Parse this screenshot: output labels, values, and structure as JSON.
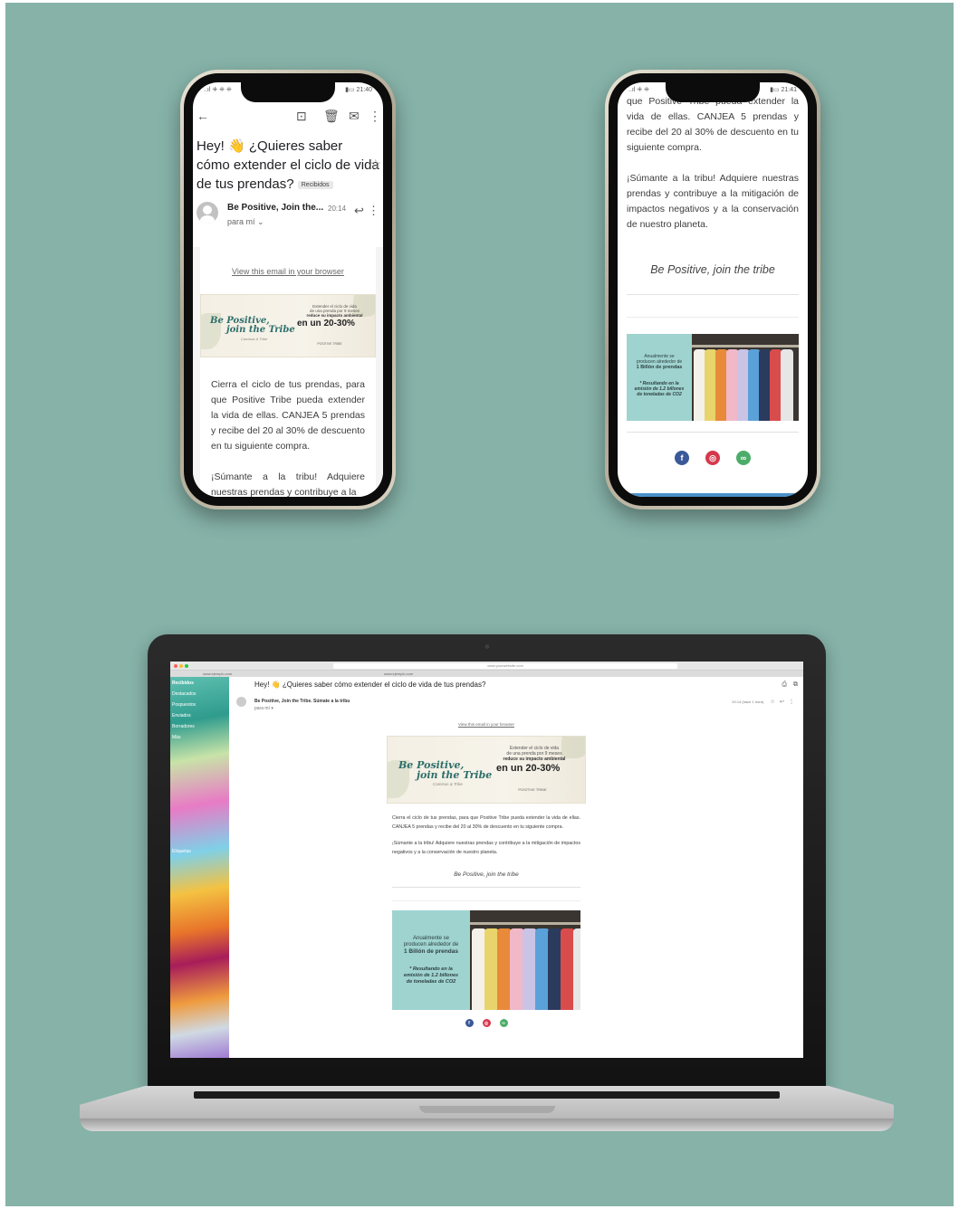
{
  "phone_left": {
    "status_left": "..ıl ⁜ ⁜ ⁜",
    "status_right": "▮▭ 21:40",
    "subject_pre": "Hey! ",
    "subject_emoji": "👋",
    "subject_text": " ¿Quieres saber cómo extender el ciclo de vida de tus prendas?",
    "inbox_label": "Recibidos",
    "sender": "Be Positive, Join the...",
    "time": "20:14",
    "to": "para mí ⌄",
    "view_link": "View this email in your browser",
    "paragraph1": "Cierra el ciclo de tus prendas, para que Positive Tribe pueda extender la vida de ellas. CANJEA 5 prendas y recibe del 20 al 30% de descuento en tu siguiente compra.",
    "paragraph2": "¡Súmante a la tribu! Adquiere nuestras prendas y contribuye a la"
  },
  "phone_right": {
    "status_left": "..ıl ⁜ ⁜",
    "status_right": "▮▭ 21:41",
    "paragraph1": "que Positive Tribe pueda extender la vida de ellas. CANJEA 5 prendas y recibe del 20 al 30% de descuento en tu siguiente compra.",
    "paragraph2": "¡Súmante a la tribu! Adquiere nuestras prendas y contribuye a la mitigación de impactos negativos y a la conservación de nuestro planeta.",
    "tagline": "Be Positive, join the tribe"
  },
  "banner": {
    "brand_line1": "Be Positive,",
    "brand_line2": "join the Tribe",
    "brand_sub": "Camisas & Tribe",
    "line1": "Extender el ciclo de vida",
    "line2": "de una prenda por 9 meses",
    "line3": "reduce su impacto ambiental",
    "big": "en un 20-30%",
    "logo": "POSITIVE TRIBE"
  },
  "promo": {
    "line1": "Anualmente se",
    "line2": "producen alrededor de",
    "line3": "1 Billón de prendas",
    "line4": "* Resultando en la",
    "line5": "emisión de 1.2 billones",
    "line6": "de toneladas de CO2"
  },
  "socials": {
    "facebook_glyph": "f",
    "instagram_glyph": "◎",
    "web_glyph": "∞"
  },
  "laptop": {
    "url": "www.yourwebsite.com",
    "tab1": "www.ejemplo.com",
    "tab2": "www.ejemplo.com",
    "subject": "Hey! 👋 ¿Quieres saber cómo extender el ciclo de vida de tus prendas?",
    "sender": "Be Positive, Join the Tribe. Súmate a la tribu",
    "to": "para mí ▾",
    "meta": "20:14 (hace 1 hora)",
    "sidebar_items": [
      "Recibidos",
      "Destacados",
      "Pospuestos",
      "Enviados",
      "Borradores",
      "Más",
      "Etiquetas"
    ],
    "view_link": "View this email in your browser",
    "paragraph1": "Cierra el ciclo de tus prendas, para que Positive Tribe pueda extender la vida de ellas. CANJEA 5 prendas y recibe del 20 al 30% de descuento en tu siguiente compra.",
    "paragraph2": "¡Súmante a la tribu! Adquiere nuestras prendas y contribuye a la mitigación de impactos negativos y a la conservación de nuestro planeta.",
    "tagline": "Be Positive, join the tribe"
  },
  "colors": {
    "background": "#86b2a8",
    "brand_teal": "#2e6f6a",
    "promo_teal": "#9fd3d0",
    "facebook": "#3b5998",
    "instagram": "#d5384d",
    "web": "#4cad6a"
  }
}
